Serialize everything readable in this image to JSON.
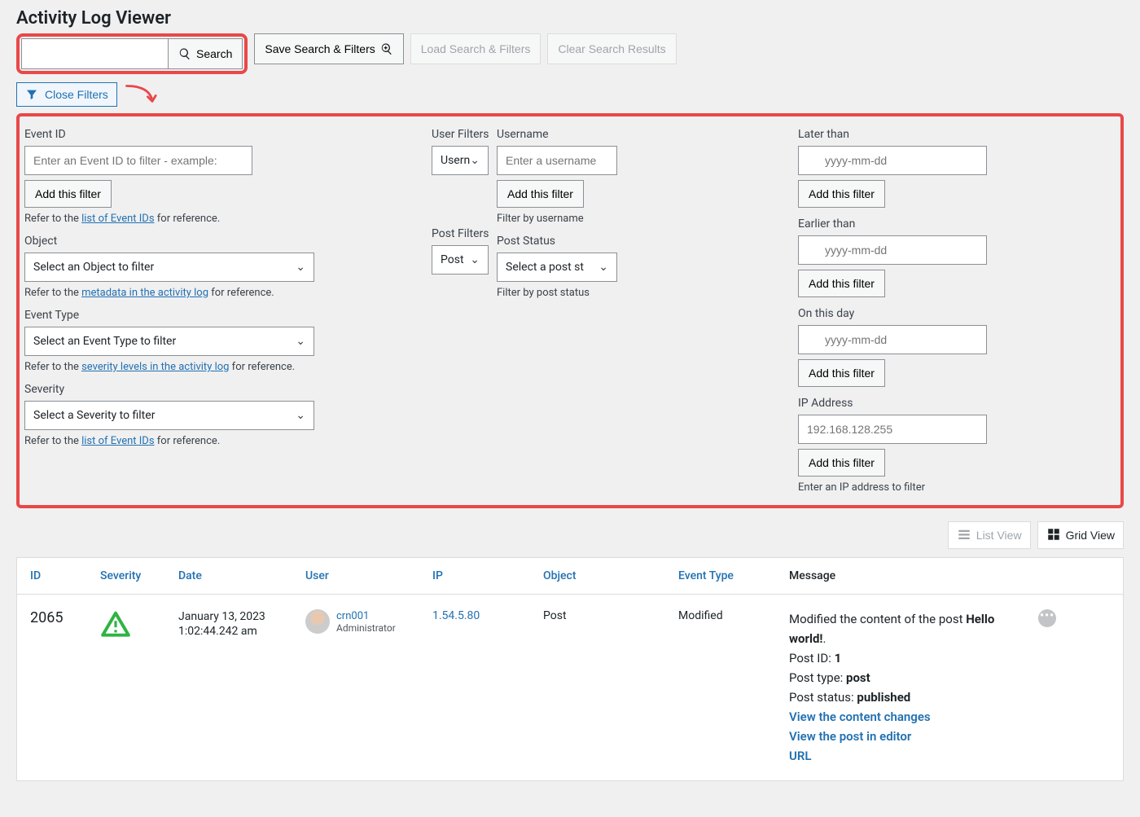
{
  "page": {
    "title": "Activity Log Viewer"
  },
  "toolbar": {
    "search_label": "Search",
    "save_label": "Save Search & Filters",
    "load_label": "Load Search & Filters",
    "clear_label": "Clear Search Results",
    "close_filters_label": "Close Filters"
  },
  "filters": {
    "event_id": {
      "label": "Event ID",
      "placeholder": "Enter an Event ID to filter - example: ",
      "add": "Add this filter",
      "help_prefix": "Refer to the ",
      "help_link": "list of Event IDs",
      "help_suffix": " for reference."
    },
    "object": {
      "label": "Object",
      "select": "Select an Object to filter",
      "help_prefix": "Refer to the ",
      "help_link": "metadata in the activity log",
      "help_suffix": " for reference."
    },
    "event_type": {
      "label": "Event Type",
      "select": "Select an Event Type to filter",
      "help_prefix": "Refer to the ",
      "help_link": "severity levels in the activity log",
      "help_suffix": " for reference."
    },
    "severity": {
      "label": "Severity",
      "select": "Select a Severity to filter",
      "help_prefix": "Refer to the ",
      "help_link": "list of Event IDs",
      "help_suffix": " for reference."
    },
    "user_filters": {
      "label": "User Filters",
      "select": "Usern"
    },
    "post_filters": {
      "label": "Post Filters",
      "select": "Post"
    },
    "username": {
      "label": "Username",
      "placeholder": "Enter a username",
      "add": "Add this filter",
      "help": "Filter by username"
    },
    "post_status": {
      "label": "Post Status",
      "select": "Select a post st",
      "help": "Filter by post status"
    },
    "later_than": {
      "label": "Later than",
      "placeholder": "yyyy-mm-dd",
      "add": "Add this filter"
    },
    "earlier_than": {
      "label": "Earlier than",
      "placeholder": "yyyy-mm-dd",
      "add": "Add this filter"
    },
    "on_this_day": {
      "label": "On this day",
      "placeholder": "yyyy-mm-dd",
      "add": "Add this filter"
    },
    "ip": {
      "label": "IP Address",
      "placeholder": "192.168.128.255",
      "add": "Add this filter",
      "help": "Enter an IP address to filter"
    }
  },
  "views": {
    "list": "List View",
    "grid": "Grid View"
  },
  "table": {
    "cols": {
      "id": "ID",
      "severity": "Severity",
      "date": "Date",
      "user": "User",
      "ip": "IP",
      "object": "Object",
      "event_type": "Event Type",
      "message": "Message"
    },
    "row1": {
      "id": "2065",
      "date_line1": "January 13, 2023",
      "date_line2": "1:02:44.242 am",
      "user_name": "crn001",
      "user_role": "Administrator",
      "ip": "1.54.5.80",
      "object": "Post",
      "event_type": "Modified",
      "msg_line": "Modified the content of the post ",
      "msg_bold": "Hello world!",
      "post_id_label": "Post ID: ",
      "post_id": "1",
      "post_type_label": "Post type: ",
      "post_type": "post",
      "post_status_label": "Post status: ",
      "post_status": "published",
      "link1": "View the content changes",
      "link2": "View the post in editor",
      "link3": "URL"
    }
  }
}
